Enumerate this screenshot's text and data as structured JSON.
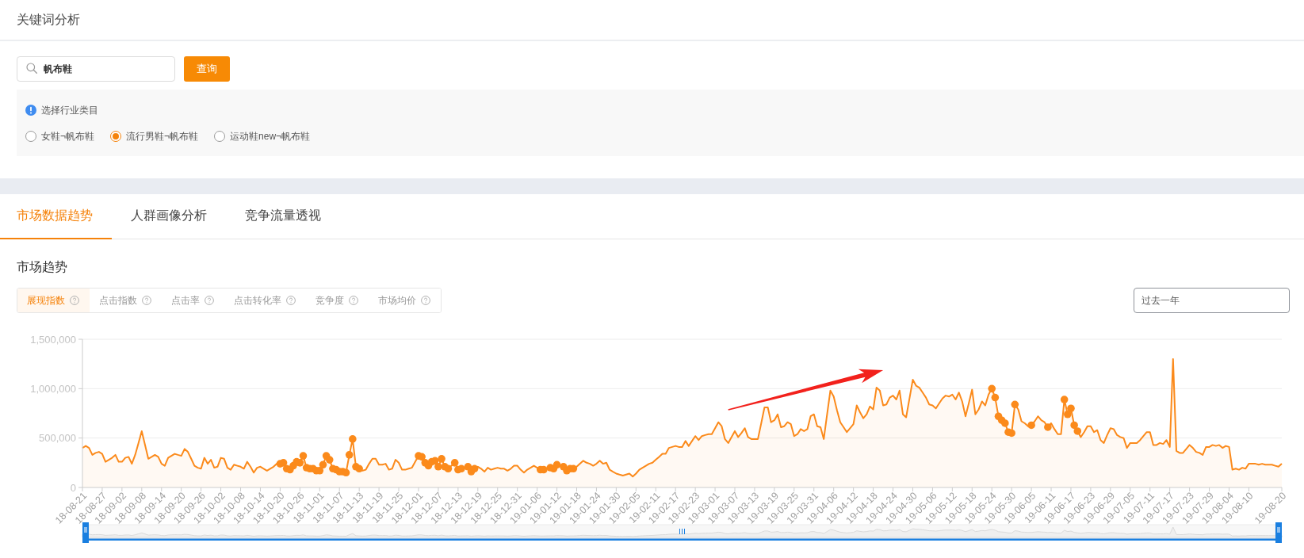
{
  "page_title": "关键词分析",
  "search": {
    "value": "帆布鞋",
    "button": "查询"
  },
  "category": {
    "label": "选择行业类目",
    "options": [
      {
        "label": "女鞋¬帆布鞋",
        "selected": false
      },
      {
        "label": "流行男鞋¬帆布鞋",
        "selected": true
      },
      {
        "label": "运动鞋new¬帆布鞋",
        "selected": false
      }
    ]
  },
  "tabs": [
    {
      "label": "市场数据趋势",
      "selected": true
    },
    {
      "label": "人群画像分析",
      "selected": false
    },
    {
      "label": "竞争流量透视",
      "selected": false
    }
  ],
  "market_trend": {
    "title": "市场趋势",
    "metrics": [
      {
        "label": "展现指数",
        "selected": true
      },
      {
        "label": "点击指数",
        "selected": false
      },
      {
        "label": "点击率",
        "selected": false
      },
      {
        "label": "点击转化率",
        "selected": false
      },
      {
        "label": "竞争度",
        "selected": false
      },
      {
        "label": "市场均价",
        "selected": false
      }
    ],
    "time_range": "过去一年",
    "chart_data": {
      "type": "area",
      "ylim": [
        0,
        1500000
      ],
      "yticks": [
        {
          "value": 0,
          "label": "0"
        },
        {
          "value": 500000,
          "label": "500,000"
        },
        {
          "value": 1000000,
          "label": "1,000,000"
        },
        {
          "value": 1500000,
          "label": "1,500,000"
        }
      ],
      "categories": [
        "18-08-21",
        null,
        null,
        null,
        null,
        null,
        "18-08-27",
        null,
        null,
        null,
        null,
        null,
        "18-09-02",
        null,
        null,
        null,
        null,
        null,
        "18-09-08",
        null,
        null,
        null,
        null,
        null,
        "18-09-14",
        null,
        null,
        null,
        null,
        null,
        "18-09-20",
        null,
        null,
        null,
        null,
        null,
        "18-09-26",
        null,
        null,
        null,
        null,
        null,
        "18-10-02",
        null,
        null,
        null,
        null,
        null,
        "18-10-08",
        null,
        null,
        null,
        null,
        null,
        "18-10-14",
        null,
        null,
        null,
        null,
        null,
        "18-10-20",
        null,
        null,
        null,
        null,
        null,
        "18-10-26",
        null,
        null,
        null,
        null,
        null,
        "18-11-01",
        null,
        null,
        null,
        null,
        null,
        "18-11-07",
        null,
        null,
        null,
        null,
        null,
        "18-11-13",
        null,
        null,
        null,
        null,
        null,
        "18-11-19",
        null,
        null,
        null,
        null,
        null,
        "18-11-25",
        null,
        null,
        null,
        null,
        null,
        "18-12-01",
        null,
        null,
        null,
        null,
        null,
        "18-12-07",
        null,
        null,
        null,
        null,
        null,
        "18-12-13",
        null,
        null,
        null,
        null,
        null,
        "18-12-19",
        null,
        null,
        null,
        null,
        null,
        "18-12-25",
        null,
        null,
        null,
        null,
        null,
        "18-12-31",
        null,
        null,
        null,
        null,
        null,
        "19-01-06",
        null,
        null,
        null,
        null,
        null,
        "19-01-12",
        null,
        null,
        null,
        null,
        null,
        "19-01-18",
        null,
        null,
        null,
        null,
        null,
        "19-01-24",
        null,
        null,
        null,
        null,
        null,
        "19-01-30",
        null,
        null,
        null,
        null,
        null,
        "19-02-05",
        null,
        null,
        null,
        null,
        null,
        "19-02-11",
        null,
        null,
        null,
        null,
        null,
        "19-02-17",
        null,
        null,
        null,
        null,
        null,
        "19-02-23",
        null,
        null,
        null,
        null,
        null,
        "19-03-01",
        null,
        null,
        null,
        null,
        null,
        "19-03-07",
        null,
        null,
        null,
        null,
        null,
        "19-03-13",
        null,
        null,
        null,
        null,
        null,
        "19-03-19",
        null,
        null,
        null,
        null,
        null,
        "19-03-25",
        null,
        null,
        null,
        null,
        null,
        "19-03-31",
        null,
        null,
        null,
        null,
        null,
        "19-04-06",
        null,
        null,
        null,
        null,
        null,
        "19-04-12",
        null,
        null,
        null,
        null,
        null,
        "19-04-18",
        null,
        null,
        null,
        null,
        null,
        "19-04-24",
        null,
        null,
        null,
        null,
        null,
        "19-04-30",
        null,
        null,
        null,
        null,
        null,
        "19-05-06",
        null,
        null,
        null,
        null,
        null,
        "19-05-12",
        null,
        null,
        null,
        null,
        null,
        "19-05-18",
        null,
        null,
        null,
        null,
        null,
        "19-05-24",
        null,
        null,
        null,
        null,
        null,
        "19-05-30",
        null,
        null,
        null,
        null,
        null,
        "19-06-05",
        null,
        null,
        null,
        null,
        null,
        "19-06-11",
        null,
        null,
        null,
        null,
        null,
        "19-06-17",
        null,
        null,
        null,
        null,
        null,
        "19-06-23",
        null,
        null,
        null,
        null,
        null,
        "19-06-29",
        null,
        null,
        null,
        null,
        null,
        "19-07-05",
        null,
        null,
        null,
        null,
        null,
        "19-07-11",
        null,
        null,
        null,
        null,
        null,
        "19-07-17",
        null,
        null,
        null,
        null,
        null,
        "19-07-23",
        null,
        null,
        null,
        null,
        null,
        "19-07-29",
        null,
        null,
        null,
        null,
        null,
        "19-08-04",
        null,
        null,
        null,
        null,
        null,
        "19-08-10",
        null,
        null,
        null,
        null,
        null,
        null,
        null,
        null,
        null,
        "19-08-20"
      ],
      "series": [
        {
          "color": "#fb8a1b",
          "values": [
            400000,
            420000,
            400000,
            330000,
            350000,
            360000,
            340000,
            260000,
            280000,
            300000,
            330000,
            260000,
            260000,
            300000,
            310000,
            240000,
            330000,
            450000,
            570000,
            430000,
            290000,
            310000,
            330000,
            310000,
            240000,
            220000,
            300000,
            320000,
            340000,
            330000,
            320000,
            390000,
            360000,
            290000,
            220000,
            200000,
            190000,
            300000,
            240000,
            280000,
            200000,
            210000,
            300000,
            290000,
            200000,
            180000,
            230000,
            220000,
            210000,
            190000,
            260000,
            210000,
            150000,
            200000,
            210000,
            190000,
            170000,
            190000,
            210000,
            240000,
            240000,
            250000,
            190000,
            180000,
            220000,
            260000,
            250000,
            320000,
            200000,
            190000,
            190000,
            170000,
            170000,
            230000,
            320000,
            280000,
            190000,
            180000,
            160000,
            160000,
            150000,
            330000,
            490000,
            210000,
            190000,
            170000,
            180000,
            240000,
            290000,
            290000,
            230000,
            230000,
            240000,
            180000,
            190000,
            280000,
            250000,
            180000,
            180000,
            190000,
            200000,
            260000,
            320000,
            310000,
            250000,
            220000,
            260000,
            270000,
            210000,
            290000,
            210000,
            190000,
            220000,
            250000,
            180000,
            190000,
            200000,
            210000,
            160000,
            190000,
            210000,
            190000,
            160000,
            200000,
            180000,
            190000,
            200000,
            190000,
            190000,
            170000,
            190000,
            220000,
            220000,
            180000,
            150000,
            180000,
            200000,
            220000,
            200000,
            180000,
            180000,
            190000,
            200000,
            190000,
            230000,
            220000,
            210000,
            170000,
            190000,
            190000,
            210000,
            240000,
            270000,
            250000,
            240000,
            220000,
            240000,
            270000,
            240000,
            250000,
            180000,
            160000,
            140000,
            130000,
            120000,
            130000,
            140000,
            110000,
            140000,
            180000,
            200000,
            220000,
            240000,
            250000,
            280000,
            310000,
            340000,
            340000,
            400000,
            410000,
            420000,
            410000,
            410000,
            470000,
            420000,
            470000,
            520000,
            480000,
            520000,
            530000,
            540000,
            540000,
            600000,
            660000,
            620000,
            490000,
            450000,
            510000,
            570000,
            510000,
            550000,
            600000,
            510000,
            490000,
            490000,
            490000,
            650000,
            810000,
            810000,
            660000,
            680000,
            740000,
            610000,
            620000,
            660000,
            640000,
            520000,
            540000,
            590000,
            570000,
            590000,
            720000,
            740000,
            620000,
            610000,
            490000,
            740000,
            980000,
            920000,
            780000,
            660000,
            610000,
            560000,
            600000,
            640000,
            830000,
            760000,
            700000,
            740000,
            820000,
            790000,
            1010000,
            980000,
            830000,
            840000,
            910000,
            930000,
            890000,
            980000,
            740000,
            710000,
            900000,
            1090000,
            1030000,
            1010000,
            960000,
            910000,
            840000,
            830000,
            800000,
            850000,
            900000,
            930000,
            920000,
            940000,
            890000,
            960000,
            870000,
            720000,
            850000,
            990000,
            740000,
            790000,
            870000,
            830000,
            940000,
            1000000,
            910000,
            720000,
            680000,
            650000,
            560000,
            550000,
            840000,
            790000,
            670000,
            650000,
            620000,
            630000,
            670000,
            720000,
            680000,
            660000,
            610000,
            650000,
            590000,
            540000,
            540000,
            890000,
            740000,
            800000,
            630000,
            570000,
            510000,
            560000,
            620000,
            620000,
            560000,
            580000,
            480000,
            450000,
            530000,
            600000,
            590000,
            530000,
            510000,
            500000,
            400000,
            450000,
            450000,
            450000,
            480000,
            520000,
            560000,
            560000,
            430000,
            430000,
            450000,
            440000,
            480000,
            410000,
            1300000,
            370000,
            350000,
            350000,
            390000,
            430000,
            400000,
            360000,
            350000,
            330000,
            410000,
            410000,
            430000,
            420000,
            430000,
            400000,
            420000,
            410000,
            180000,
            190000,
            180000,
            200000,
            190000,
            240000,
            240000,
            240000,
            230000,
            240000,
            230000,
            230000,
            230000,
            220000,
            210000,
            240000
          ]
        },
        {
          "type": "scatter",
          "color": "#fb8a1b",
          "values": [
            null,
            null,
            null,
            null,
            null,
            null,
            null,
            null,
            null,
            null,
            null,
            null,
            null,
            null,
            null,
            null,
            null,
            null,
            null,
            null,
            null,
            null,
            null,
            null,
            null,
            null,
            null,
            null,
            null,
            null,
            null,
            null,
            null,
            null,
            null,
            null,
            null,
            null,
            null,
            null,
            null,
            null,
            null,
            null,
            null,
            null,
            null,
            null,
            null,
            null,
            null,
            null,
            null,
            null,
            null,
            null,
            null,
            null,
            null,
            null,
            240000,
            250000,
            190000,
            180000,
            220000,
            260000,
            250000,
            320000,
            200000,
            190000,
            190000,
            170000,
            170000,
            230000,
            320000,
            280000,
            190000,
            180000,
            160000,
            160000,
            150000,
            330000,
            490000,
            210000,
            190000,
            null,
            null,
            null,
            null,
            null,
            null,
            null,
            null,
            null,
            null,
            null,
            null,
            null,
            null,
            null,
            null,
            null,
            320000,
            310000,
            250000,
            220000,
            260000,
            270000,
            210000,
            290000,
            210000,
            190000,
            null,
            250000,
            180000,
            190000,
            null,
            210000,
            160000,
            190000,
            null,
            null,
            null,
            null,
            null,
            null,
            null,
            null,
            null,
            null,
            null,
            null,
            null,
            null,
            null,
            null,
            null,
            null,
            null,
            180000,
            180000,
            null,
            200000,
            190000,
            230000,
            null,
            210000,
            170000,
            190000,
            190000,
            null,
            null,
            null,
            null,
            null,
            null,
            null,
            null,
            null,
            null,
            null,
            null,
            null,
            null,
            null,
            null,
            null,
            null,
            null,
            null,
            null,
            null,
            null,
            null,
            null,
            null,
            null,
            null,
            null,
            null,
            null,
            null,
            null,
            null,
            null,
            null,
            null,
            null,
            null,
            null,
            null,
            null,
            null,
            null,
            null,
            null,
            null,
            null,
            null,
            null,
            null,
            null,
            null,
            null,
            null,
            null,
            null,
            null,
            null,
            null,
            null,
            null,
            null,
            null,
            null,
            null,
            null,
            null,
            null,
            null,
            null,
            null,
            null,
            null,
            null,
            null,
            null,
            null,
            null,
            null,
            null,
            null,
            null,
            null,
            null,
            null,
            null,
            null,
            null,
            null,
            null,
            null,
            null,
            null,
            null,
            null,
            null,
            null,
            null,
            null,
            null,
            null,
            null,
            null,
            null,
            null,
            null,
            null,
            null,
            null,
            null,
            null,
            null,
            null,
            null,
            null,
            null,
            null,
            null,
            null,
            null,
            null,
            null,
            null,
            null,
            null,
            1000000,
            910000,
            720000,
            680000,
            650000,
            560000,
            550000,
            840000,
            null,
            null,
            null,
            null,
            630000,
            null,
            null,
            null,
            null,
            610000,
            null,
            null,
            null,
            null,
            890000,
            740000,
            800000,
            630000,
            570000,
            null,
            null,
            null,
            null,
            null,
            null,
            null,
            null,
            null,
            null,
            null,
            null,
            null,
            null,
            null,
            null,
            null,
            null,
            null,
            null,
            null,
            null,
            null,
            null,
            null,
            null,
            null,
            null,
            null,
            null,
            null,
            null,
            null,
            null,
            null,
            null,
            null,
            null,
            null,
            null,
            null,
            null,
            null,
            null,
            null,
            null,
            null,
            null,
            null,
            null,
            null,
            null,
            null,
            null,
            null,
            null,
            null,
            null,
            null,
            null,
            null,
            null
          ]
        }
      ]
    }
  }
}
